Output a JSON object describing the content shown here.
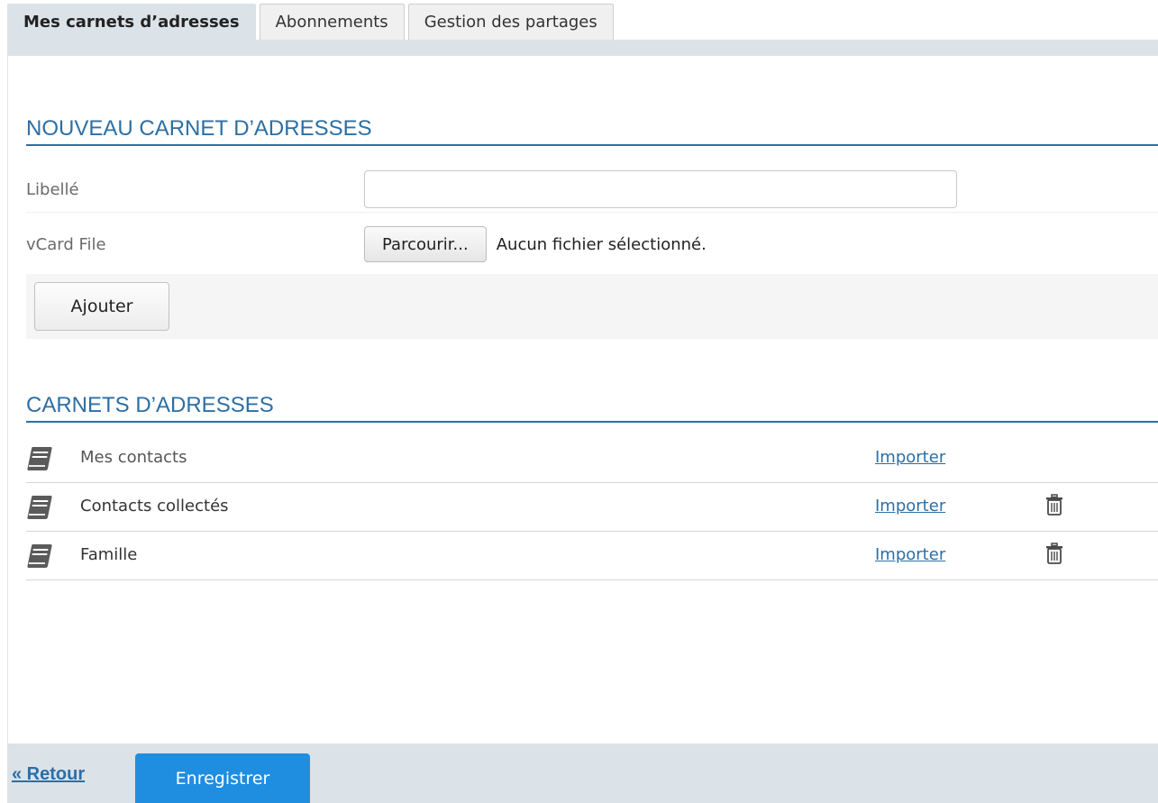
{
  "tabs": [
    {
      "label": "Mes carnets d’adresses",
      "active": true
    },
    {
      "label": "Abonnements",
      "active": false
    },
    {
      "label": "Gestion des partages",
      "active": false
    }
  ],
  "new_section": {
    "title": "NOUVEAU CARNET D’ADRESSES",
    "label_field": {
      "label": "Libellé",
      "value": "",
      "placeholder": ""
    },
    "vcard_field": {
      "label": "vCard File",
      "browse_label": "Parcourir...",
      "status": "Aucun fichier sélectionné."
    },
    "add_label": "Ajouter"
  },
  "list_section": {
    "title": "CARNETS D’ADRESSES",
    "items": [
      {
        "name": "Mes contacts",
        "import_label": "Importer",
        "icon": "address-book-icon",
        "deletable": false
      },
      {
        "name": "Contacts collectés",
        "import_label": "Importer",
        "icon": "address-book-icon",
        "deletable": true
      },
      {
        "name": "Famille",
        "import_label": "Importer",
        "icon": "address-book-icon",
        "deletable": true
      }
    ]
  },
  "footer": {
    "back_label": "« Retour",
    "save_label": "Enregistrer"
  },
  "colors": {
    "accent": "#2c6fa5",
    "primary_button": "#1f8ee0",
    "bar_background": "#dbe2e8"
  }
}
